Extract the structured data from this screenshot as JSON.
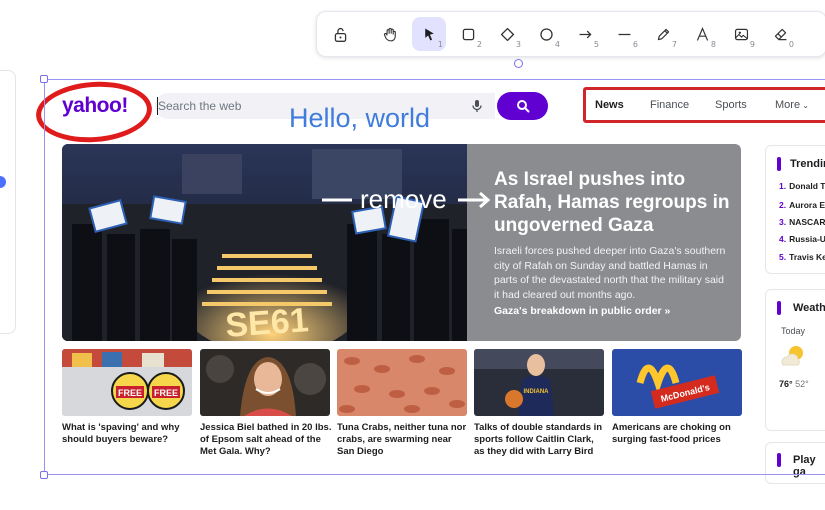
{
  "toolbar": {
    "tools": [
      {
        "name": "lock",
        "key": ""
      },
      {
        "name": "hand",
        "key": ""
      },
      {
        "name": "selection",
        "key": "1"
      },
      {
        "name": "rectangle",
        "key": "2"
      },
      {
        "name": "diamond",
        "key": "3"
      },
      {
        "name": "ellipse",
        "key": "4"
      },
      {
        "name": "arrow",
        "key": "5"
      },
      {
        "name": "line",
        "key": "6"
      },
      {
        "name": "draw",
        "key": "7"
      },
      {
        "name": "text",
        "key": "8"
      },
      {
        "name": "image",
        "key": "9"
      },
      {
        "name": "eraser",
        "key": "0"
      }
    ],
    "active_tool": "selection"
  },
  "header": {
    "logo": "yahoo!",
    "search_placeholder": "Search the web",
    "nav": [
      "News",
      "Finance",
      "Sports",
      "More"
    ]
  },
  "annotations": {
    "hello_text": "Hello, world",
    "remove_text": "remove"
  },
  "hero": {
    "title": "As Israel pushes into Rafah, Hamas regroups in ungoverned Gaza",
    "summary": "Israeli forces pushed deeper into Gaza's southern city of Rafah on Sunday and battled Hamas in parts of the devastated north that the military said it had cleared out months ago.",
    "cta": "Gaza's breakdown in public order",
    "cta_arrow": "»",
    "photo_candle_text": "SE61"
  },
  "cards": [
    {
      "caption": "What is 'spaving' and why should buyers beware?",
      "badges": [
        "FREE",
        "FREE"
      ]
    },
    {
      "caption": "Jessica Biel bathed in 20 lbs. of Epsom salt ahead of the Met Gala. Why?"
    },
    {
      "caption": "Tuna Crabs, neither tuna nor crabs, are swarming near San Diego"
    },
    {
      "caption": "Talks of double standards in sports follow Caitlin Clark, as they did with Larry Bird",
      "jersey": "INDIANA"
    },
    {
      "caption": "Americans are choking on surging fast-food prices",
      "sign": "McDonald's"
    }
  ],
  "trending": {
    "title": "Trendin",
    "items": [
      {
        "num": "1.",
        "text": "Donald T"
      },
      {
        "num": "2.",
        "text": "Aurora E"
      },
      {
        "num": "3.",
        "text": "NASCAR"
      },
      {
        "num": "4.",
        "text": "Russia-U"
      },
      {
        "num": "5.",
        "text": "Travis Ke"
      }
    ]
  },
  "weather": {
    "title": "Weath",
    "day": "Today",
    "high": "76°",
    "low": "52°"
  },
  "games": {
    "title": "Play ga"
  },
  "colors": {
    "yahoo_purple": "#6001d2",
    "annotation_red": "#e01b1b",
    "annotation_blue": "#3f7cdc",
    "selection": "#9b93f2"
  }
}
